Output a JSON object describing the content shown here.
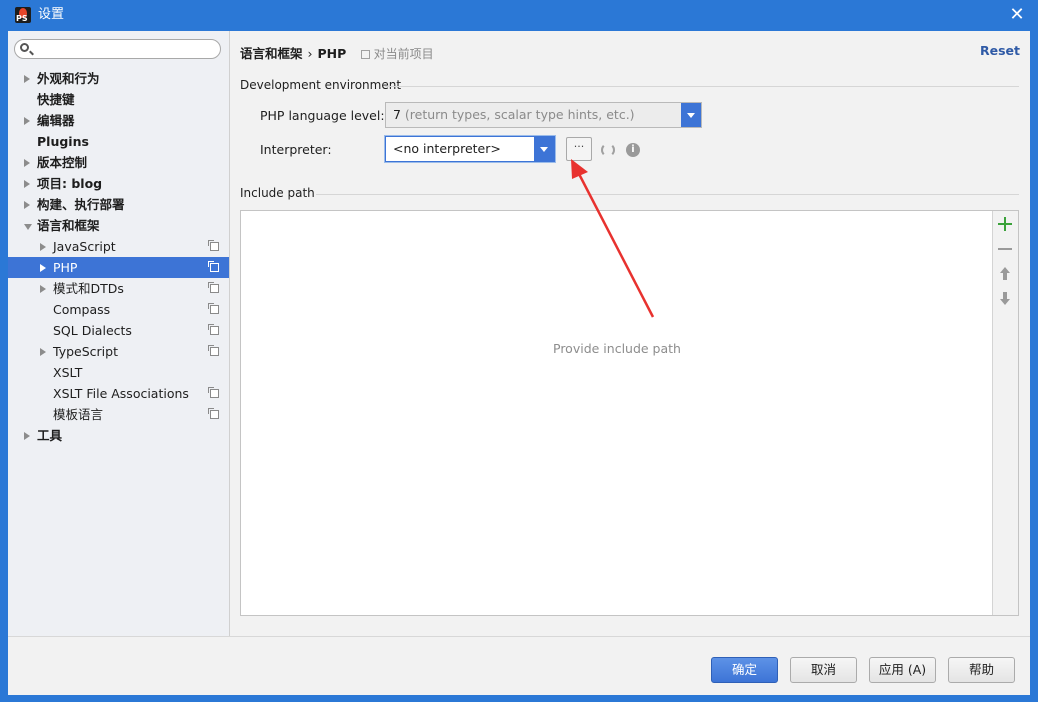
{
  "window": {
    "title": "设置",
    "close_glyph": "✕"
  },
  "sidebar": {
    "search": {
      "value": "",
      "placeholder": ""
    },
    "items": [
      {
        "label": "外观和行为",
        "expand": "collapsed",
        "bold": true
      },
      {
        "label": "快捷键",
        "expand": "none",
        "bold": true
      },
      {
        "label": "编辑器",
        "expand": "collapsed",
        "bold": true
      },
      {
        "label": "Plugins",
        "expand": "none",
        "bold": true
      },
      {
        "label": "版本控制",
        "expand": "collapsed",
        "bold": true
      },
      {
        "label": "项目: blog",
        "expand": "collapsed",
        "bold": true
      },
      {
        "label": "构建、执行部署",
        "expand": "collapsed",
        "bold": true
      },
      {
        "label": "语言和框架",
        "expand": "expanded",
        "bold": true
      },
      {
        "label": "JavaScript",
        "expand": "collapsed",
        "child": true
      },
      {
        "label": "PHP",
        "expand": "collapsed",
        "child": true,
        "selected": true
      },
      {
        "label": "模式和DTDs",
        "expand": "collapsed",
        "child": true
      },
      {
        "label": "Compass",
        "expand": "none",
        "child": true
      },
      {
        "label": "SQL Dialects",
        "expand": "none",
        "child": true
      },
      {
        "label": "TypeScript",
        "expand": "collapsed",
        "child": true
      },
      {
        "label": "XSLT",
        "expand": "none",
        "child": true
      },
      {
        "label": "XSLT File Associations",
        "expand": "none",
        "child": true
      },
      {
        "label": "模板语言",
        "expand": "none",
        "child": true
      },
      {
        "label": "工具",
        "expand": "collapsed",
        "bold": true
      }
    ]
  },
  "main": {
    "breadcrumb": {
      "parent": "语言和框架",
      "separator": "›",
      "current": "PHP",
      "scope": "对当前项目"
    },
    "reset_label": "Reset",
    "dev_env_label": "Development environment",
    "php_level": {
      "label": "PHP language level:",
      "value_main": "7",
      "value_hint": " (return types, scalar type hints, etc.)"
    },
    "interpreter": {
      "label": "Interpreter:",
      "value": "<no interpreter>",
      "ellipsis": "···"
    },
    "include_path": {
      "label": "Include path",
      "empty_text": "Provide include path"
    },
    "info_glyph": "i"
  },
  "footer": {
    "ok": "确定",
    "cancel": "取消",
    "apply": "应用 (A)",
    "help": "帮助"
  },
  "colors": {
    "titlebar": "#2b78d6",
    "selection": "#3d74d6",
    "annotation_arrow": "#e8322f",
    "add_green": "#3aa23a"
  }
}
